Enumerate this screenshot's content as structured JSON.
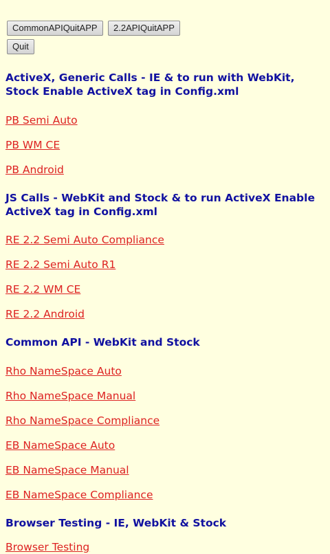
{
  "buttons": {
    "common_quit": "CommonAPIQuitAPP",
    "api22_quit": "2.2APIQuitAPP",
    "quit": "Quit"
  },
  "sections": [
    {
      "heading": "ActiveX, Generic Calls - IE & to run with WebKit, Stock Enable ActiveX tag in Config.xml",
      "links": [
        "PB Semi Auto",
        "PB WM CE",
        "PB Android"
      ]
    },
    {
      "heading": "JS Calls - WebKit and Stock & to run ActiveX Enable ActiveX tag in Config.xml",
      "links": [
        "RE 2.2 Semi Auto Compliance",
        "RE 2.2 Semi Auto R1",
        "RE 2.2 WM CE",
        "RE 2.2 Android"
      ]
    },
    {
      "heading": "Common API - WebKit and Stock",
      "links": [
        "Rho NameSpace Auto",
        "Rho NameSpace Manual",
        "Rho NameSpace Compliance",
        "EB NameSpace Auto",
        "EB NameSpace Manual",
        "EB NameSpace Compliance"
      ]
    },
    {
      "heading": "Browser Testing - IE, WebKit & Stock",
      "links": [
        "Browser Testing"
      ]
    }
  ],
  "colors": {
    "background": "#FFFFE0",
    "heading": "#1111A0",
    "link": "#DD2222"
  }
}
